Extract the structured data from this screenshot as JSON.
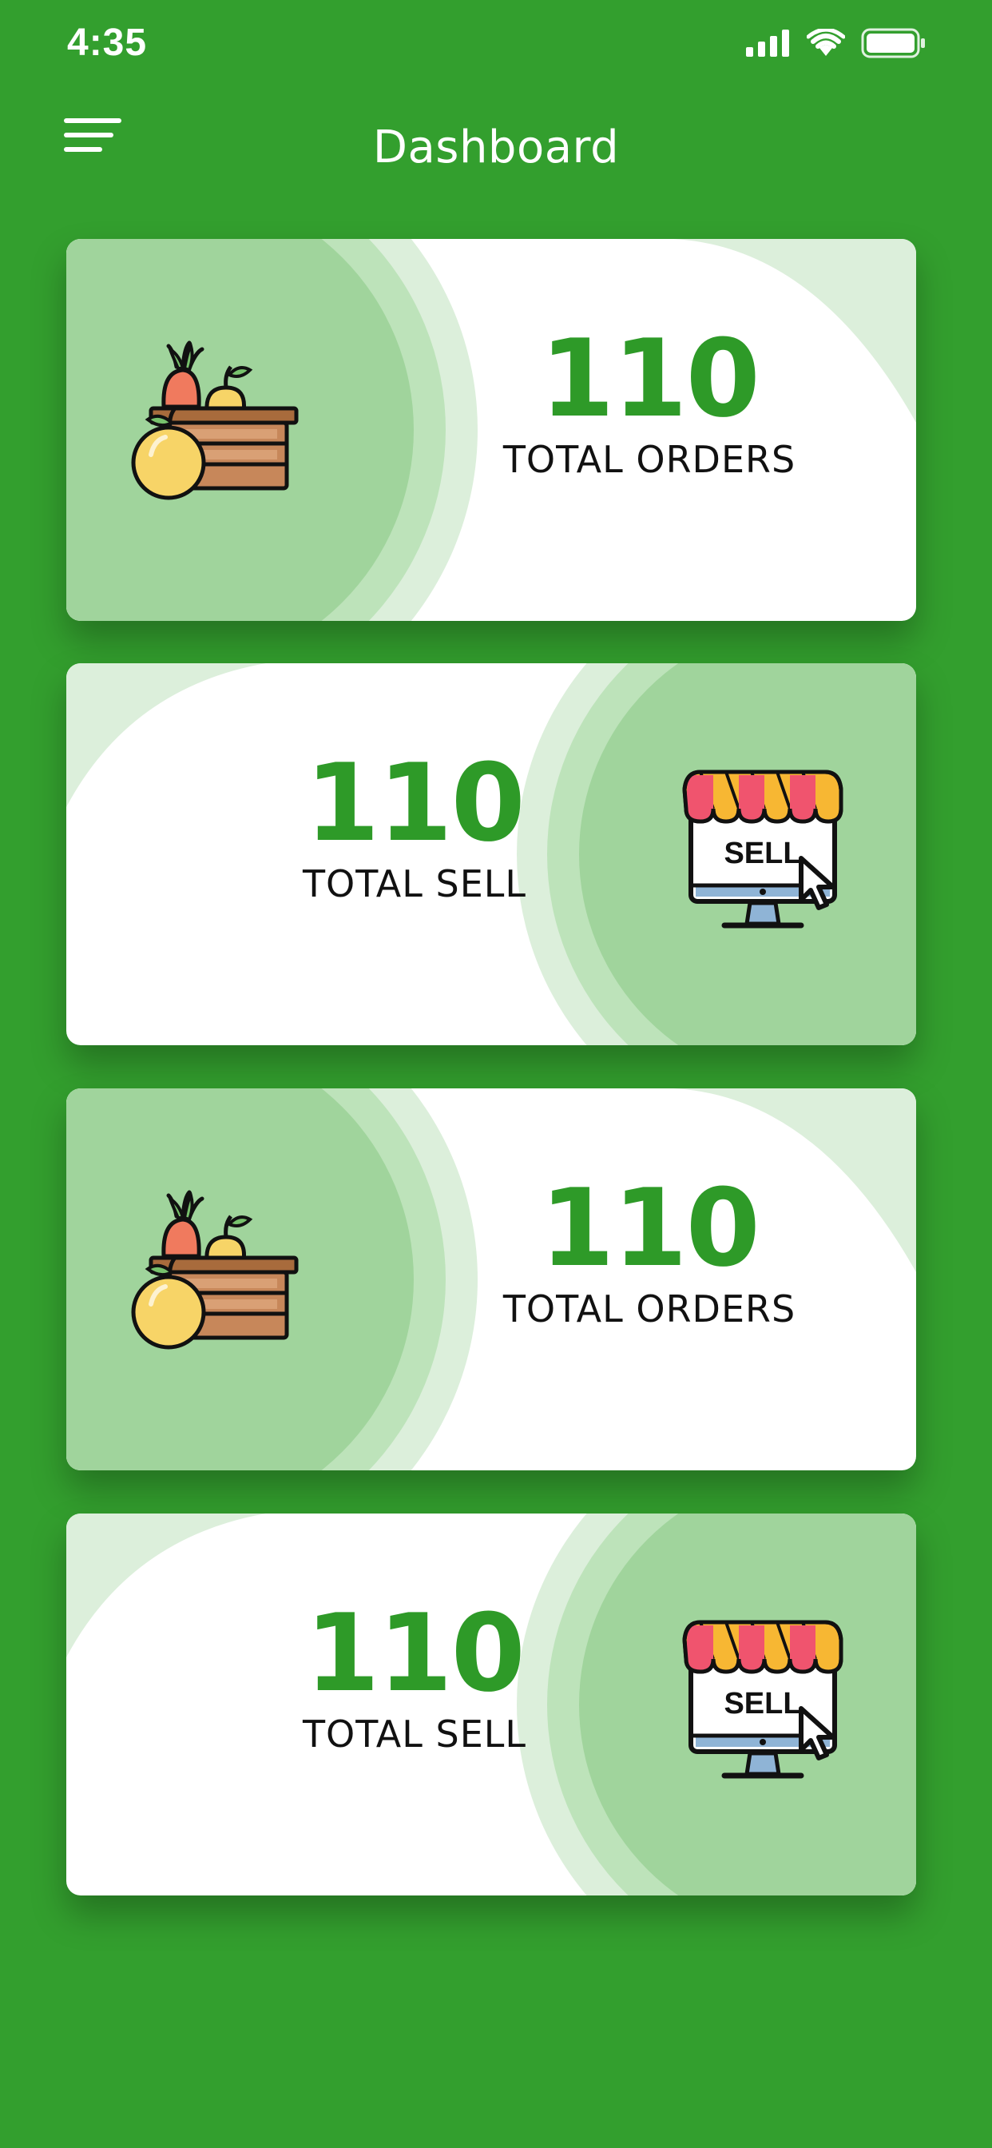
{
  "status_bar": {
    "time": "4:35"
  },
  "header": {
    "title": "Dashboard"
  },
  "cards": [
    {
      "value": "110",
      "label": "TOTAL ORDERS",
      "icon": "produce-crate-icon"
    },
    {
      "value": "110",
      "label": "TOTAL SELL",
      "icon": "online-shop-sell-icon"
    },
    {
      "value": "110",
      "label": "TOTAL ORDERS",
      "icon": "produce-crate-icon"
    },
    {
      "value": "110",
      "label": "TOTAL SELL",
      "icon": "online-shop-sell-icon"
    }
  ],
  "sell_sign": "SELL",
  "colors": {
    "background": "#339F2E",
    "accent": "#2E9A28",
    "card": "#FFFFFF",
    "circle_light": "#DCEFDB",
    "circle_mid": "#BDE3BA",
    "circle_dark": "#A0D49C"
  }
}
